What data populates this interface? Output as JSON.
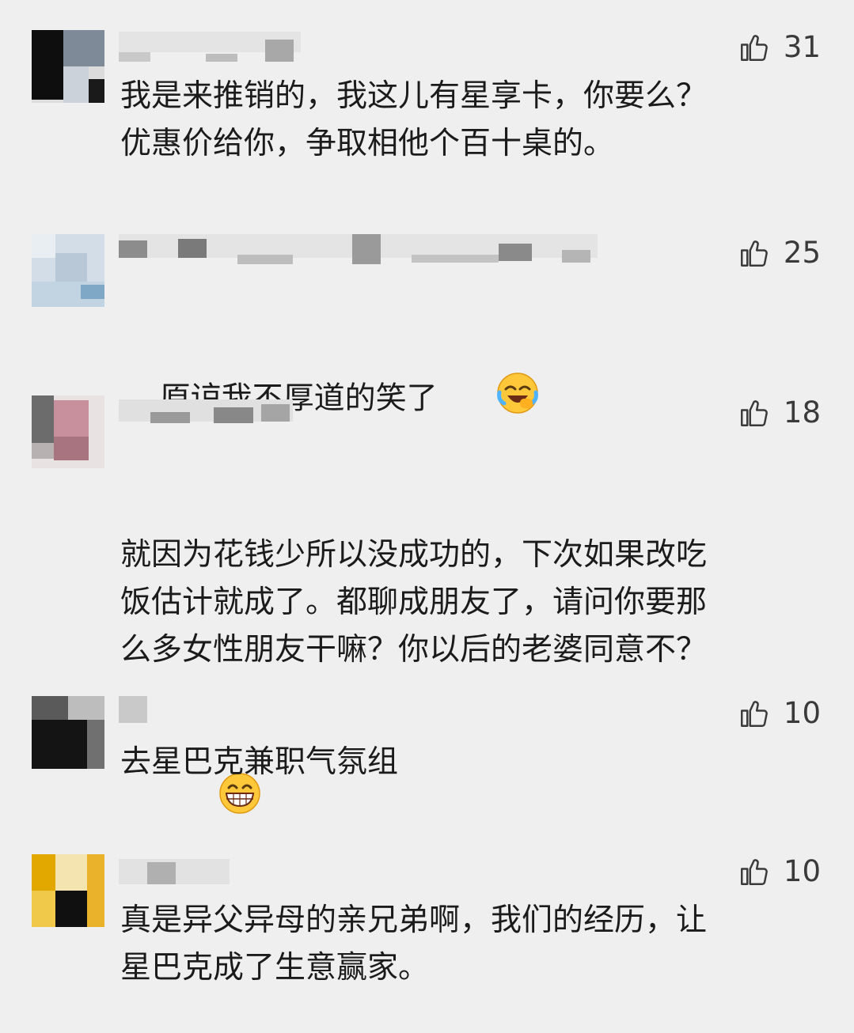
{
  "comments": [
    {
      "likes": "31",
      "text": "我是来推销的，我这儿有星享卡，你要么？\n优惠价给你，争取相他个百十桌的。"
    },
    {
      "likes": "25",
      "text": "原谅我不厚道的笑了",
      "emoji": "laughing-crying-emoji"
    },
    {
      "likes": "18",
      "text": "就因为花钱少所以没成功的，下次如果改吃\n饭估计就成了。都聊成朋友了，请问你要那\n么多女性朋友干嘛？你以后的老婆同意不？",
      "emoji": "grinning-emoji"
    },
    {
      "likes": "10",
      "text": "去星巴克兼职气氛组"
    },
    {
      "likes": "10",
      "text": "真是异父异母的亲兄弟啊，我们的经历，让\n星巴克成了生意赢家。"
    }
  ],
  "colors": {
    "background": "#efefef",
    "text": "#1b1b1b",
    "like_count": "#3a3a3a"
  }
}
